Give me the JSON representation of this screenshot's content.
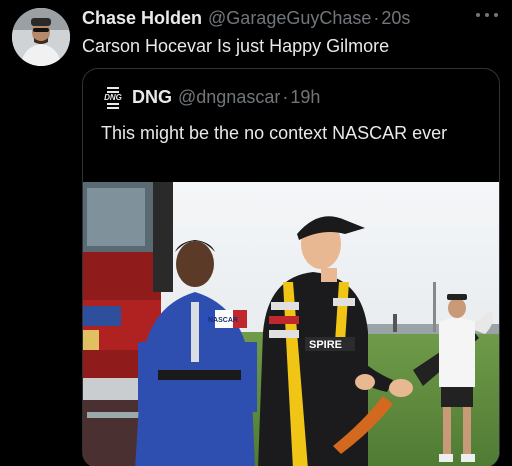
{
  "tweet": {
    "author_name": "Chase Holden",
    "author_handle": "@GarageGuyChase",
    "separator": "·",
    "time": "20s",
    "text": "Carson Hocevar Is just Happy Gilmore",
    "avatar_icon": "user-avatar-icon",
    "more_icon": "more-options-icon"
  },
  "quote": {
    "logo_text": "DNG",
    "author_name": "DNG",
    "author_handle": "@dngnascar",
    "separator": "·",
    "time": "19h",
    "text": "This might be the no context NASCAR ever"
  },
  "media": {
    "jacket_top": "NASCAR",
    "jacket_chest": "SPIRE"
  },
  "colors": {
    "background": "#000000",
    "text_primary": "#e7e9ea",
    "text_secondary": "#71767b",
    "border": "#2f3336"
  }
}
